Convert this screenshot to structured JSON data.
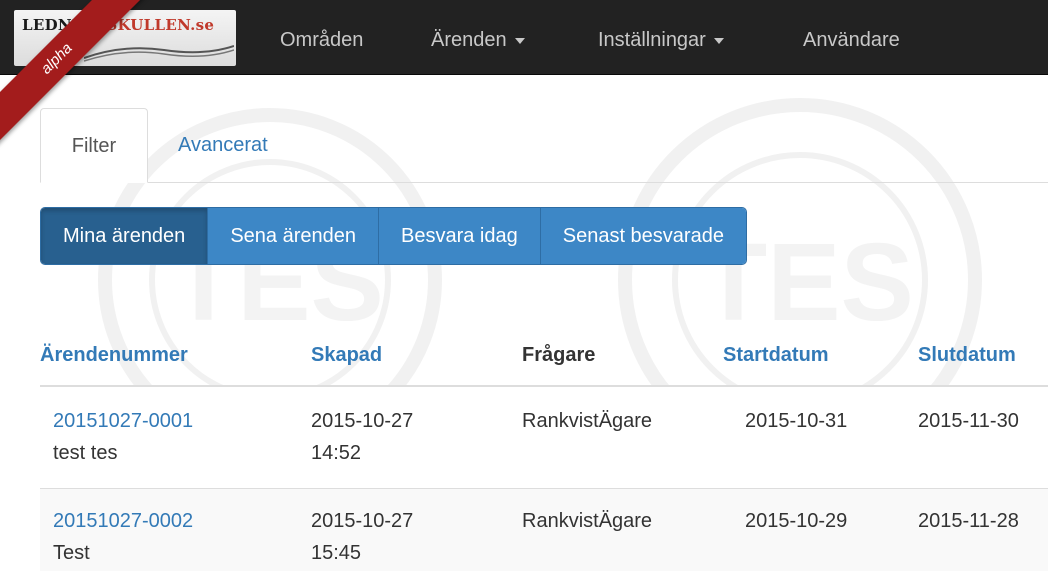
{
  "brand": {
    "logo_prefix": "LEDNI",
    "logo_mid": "NGSK",
    "logo_mid2": "ULLEN.se"
  },
  "ribbon": {
    "label": "alpha"
  },
  "nav": {
    "items": [
      {
        "label": "Områden",
        "dropdown": false
      },
      {
        "label": "Ärenden",
        "dropdown": true
      },
      {
        "label": "Inställningar",
        "dropdown": true
      },
      {
        "label": "Användare",
        "dropdown": false
      }
    ]
  },
  "tabs": [
    {
      "label": "Filter",
      "active": true
    },
    {
      "label": "Avancerat",
      "active": false
    }
  ],
  "filters": [
    {
      "label": "Mina ärenden",
      "active": true
    },
    {
      "label": "Sena ärenden",
      "active": false
    },
    {
      "label": "Besvara idag",
      "active": false
    },
    {
      "label": "Senast besvarade",
      "active": false
    }
  ],
  "table": {
    "columns": [
      {
        "label": "Ärendenummer",
        "sortable": true
      },
      {
        "label": "Skapad",
        "sortable": true
      },
      {
        "label": "Frågare",
        "sortable": false
      },
      {
        "label": "Startdatum",
        "sortable": true
      },
      {
        "label": "Slutdatum",
        "sortable": true
      }
    ],
    "rows": [
      {
        "number": "20151027-0001",
        "title": "test tes",
        "created_date": "2015-10-27",
        "created_time": "14:52",
        "asker": "RankvistÄgare",
        "start": "2015-10-31",
        "end": "2015-11-30"
      },
      {
        "number": "20151027-0002",
        "title": "Test",
        "created_date": "2015-10-27",
        "created_time": "15:45",
        "asker": "RankvistÄgare",
        "start": "2015-10-29",
        "end": "2015-11-28"
      }
    ]
  },
  "colors": {
    "navbar": "#222222",
    "link": "#337ab7",
    "button": "#3d87c6",
    "button_active": "#28608f",
    "ribbon": "#a31c1c"
  }
}
